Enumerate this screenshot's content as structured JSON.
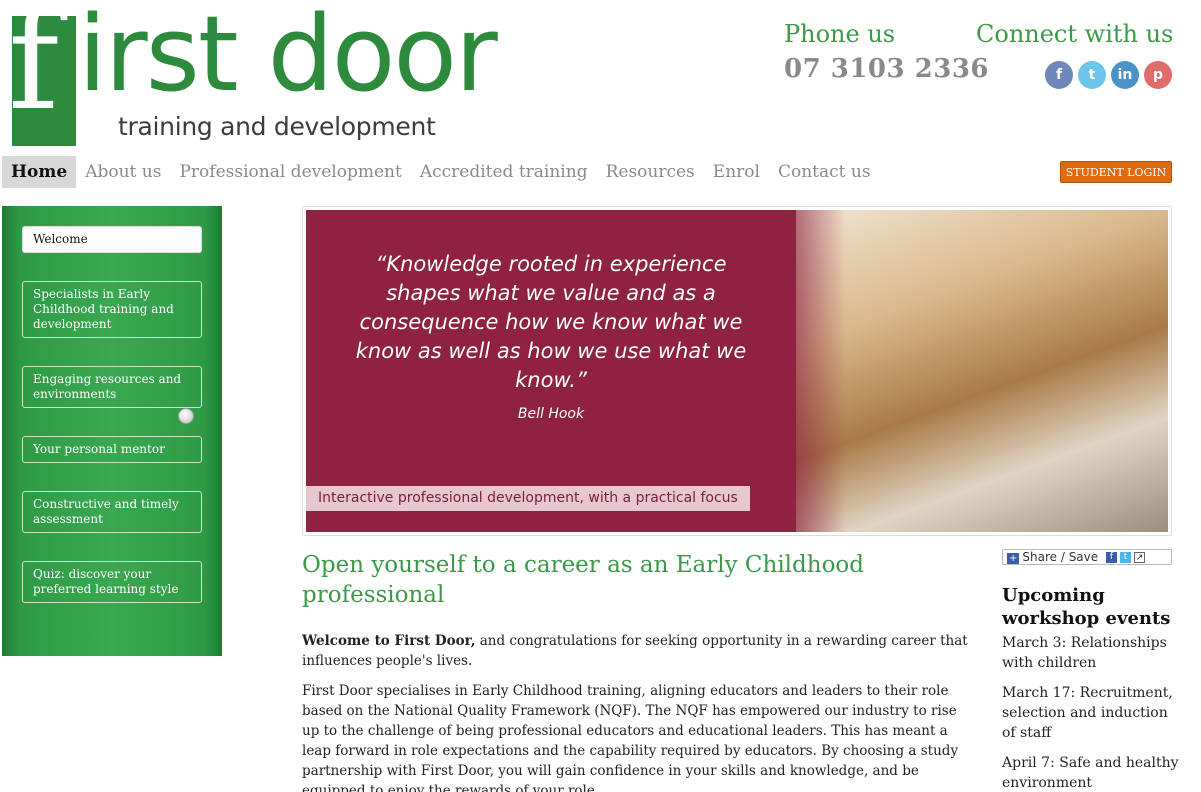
{
  "header": {
    "logo_letter": "f",
    "logo_word": "irst door",
    "logo_tagline": "training and development",
    "phone_label": "Phone us",
    "phone_number": "07 3103 2336",
    "connect_label": "Connect with us",
    "social": [
      {
        "icon": "facebook-icon",
        "glyph": "f"
      },
      {
        "icon": "twitter-icon",
        "glyph": "t"
      },
      {
        "icon": "linkedin-icon",
        "glyph": "in"
      },
      {
        "icon": "pinterest-icon",
        "glyph": "p"
      }
    ]
  },
  "nav": {
    "items": [
      "Home",
      "About us",
      "Professional development",
      "Accredited training",
      "Resources",
      "Enrol",
      "Contact us"
    ],
    "active": "Home",
    "student_login": "STUDENT LOGIN"
  },
  "sidebar": {
    "items": [
      "Welcome",
      "Specialists in Early Childhood training and development",
      "Engaging resources and environments",
      "Your personal mentor",
      "Constructive and timely assessment",
      "Quiz: discover your preferred learning style"
    ]
  },
  "banner": {
    "quote": "“Knowledge rooted in experience shapes what we value and as a consequence how we know what we know as well as how we use what we know.”",
    "author": "Bell Hook",
    "caption": "Interactive professional development, with a practical focus"
  },
  "main": {
    "title": "Open yourself to a career as an Early Childhood professional",
    "para1_bold": "Welcome to First Door,",
    "para1_rest": " and congratulations for seeking opportunity in a rewarding career that influences people's lives.",
    "para2": "First Door specialises in Early Childhood training, aligning educators and leaders to their role based on the National Quality Framework (NQF). The NQF has empowered our industry to rise up to the challenge of being professional educators and educational leaders. This has meant a leap forward in role expectations and the capability required by educators. By choosing a study partnership with First Door, you will gain confidence in your skills and knowledge, and be equipped to enjoy the rewards of your role."
  },
  "right": {
    "share_label": "Share / Save",
    "upcoming_title": "Upcoming workshop events",
    "events": [
      "March 3: Relationships with children",
      "March 17: Recruitment, selection and induction of staff",
      "April 7: Safe and healthy environment"
    ]
  },
  "colors": {
    "brand_green": "#2e8b3e",
    "heading_green": "#3a9a48",
    "banner_maroon": "#8e2240",
    "login_orange": "#e06a0f"
  }
}
